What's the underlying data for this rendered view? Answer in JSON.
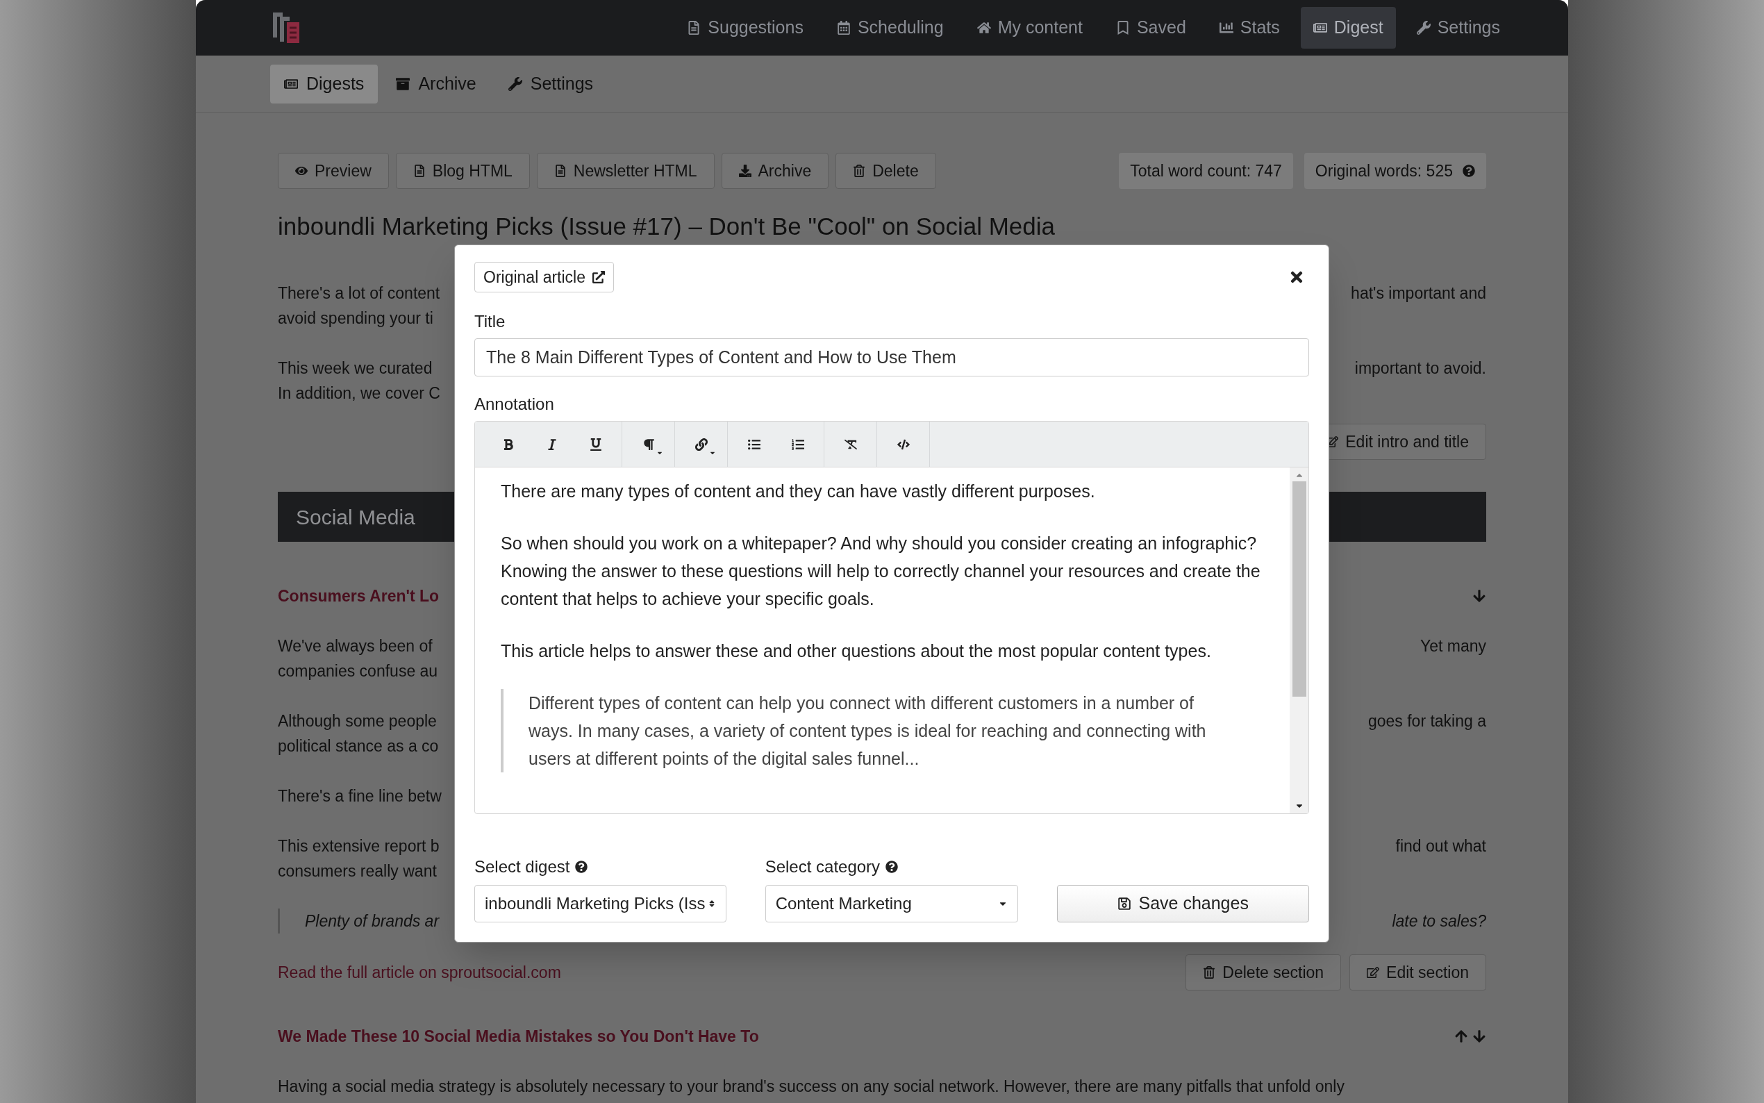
{
  "nav": {
    "items": [
      {
        "label": "Suggestions",
        "selected": false
      },
      {
        "label": "Scheduling",
        "selected": false
      },
      {
        "label": "My content",
        "selected": false
      },
      {
        "label": "Saved",
        "selected": false
      },
      {
        "label": "Stats",
        "selected": false
      },
      {
        "label": "Digest",
        "selected": true
      },
      {
        "label": "Settings",
        "selected": false
      }
    ]
  },
  "subnav": {
    "items": [
      {
        "label": "Digests",
        "selected": true
      },
      {
        "label": "Archive",
        "selected": false
      },
      {
        "label": "Settings",
        "selected": false
      }
    ]
  },
  "toolbar": {
    "buttons": [
      "Preview",
      "Blog HTML",
      "Newsletter HTML",
      "Archive",
      "Delete"
    ],
    "word_count": "Total word count: 747",
    "original_words": "Original words: 525"
  },
  "digest": {
    "heading": "inboundli Marketing Picks (Issue #17) – Don't Be \"Cool\" on Social Media",
    "intro": [
      {
        "lines": [
          {
            "left": "There's a lot of content",
            "right": "hat's important and"
          },
          {
            "left": "avoid spending your ti"
          }
        ]
      },
      {
        "lines": [
          {
            "left": "This week we curated",
            "right": "important to avoid."
          },
          {
            "left": "In addition, we cover C"
          }
        ]
      }
    ],
    "edit_button": "Edit intro and title"
  },
  "section": {
    "title": "Social Media",
    "articles": [
      {
        "title": "Consumers Aren't Lo",
        "can_move_up": false,
        "can_move_down": true,
        "blocks": [
          {
            "kind": "text",
            "lines": [
              {
                "left": "We've always been of",
                "right": "Yet many"
              },
              {
                "left": "companies confuse au"
              }
            ]
          },
          {
            "kind": "text",
            "lines": [
              {
                "left": "Although some people",
                "right": "goes for taking a"
              },
              {
                "left": "political stance as a co"
              }
            ]
          },
          {
            "kind": "text",
            "lines": [
              {
                "left": "There's a fine line betw"
              }
            ]
          },
          {
            "kind": "text",
            "lines": [
              {
                "left": "This extensive report b",
                "right": "find out what"
              },
              {
                "left": "consumers really want"
              }
            ]
          },
          {
            "kind": "quote",
            "lines": [
              {
                "left": "Plenty of brands ar",
                "right": "late to sales?"
              }
            ]
          }
        ],
        "link": "Read the full article on sproutsocial.com",
        "delete_button": "Delete section",
        "edit_button": "Edit section"
      },
      {
        "title": "We Made These 10 Social Media Mistakes so You Don't Have To",
        "can_move_up": true,
        "can_move_down": true,
        "blocks": [
          {
            "kind": "text",
            "lines": [
              {
                "left": "Having a social media strategy is absolutely necessary to your brand's success on any social network. However, there are many pitfalls that unfold only"
              }
            ]
          }
        ]
      }
    ]
  },
  "modal": {
    "original_article": "Original article",
    "title_label": "Title",
    "title_value": "The 8 Main Different Types of Content and How to Use Them",
    "annotation_label": "Annotation",
    "annotation": [
      {
        "kind": "paragraph",
        "text": "There are many types of content and they can have vastly different purposes."
      },
      {
        "kind": "paragraph",
        "text": "So when should you work on a whitepaper? And why should you consider creating an infographic? Knowing the answer to these questions will help to correctly channel your resources and create the content that helps to achieve your specific goals."
      },
      {
        "kind": "paragraph",
        "text": "This article helps to answer these and other questions about the most popular content types."
      },
      {
        "kind": "quote",
        "text": "Different types of content can help you connect with different customers in a number of ways. In many cases, a variety of content types is ideal for reaching and connecting with users at different points of the digital sales funnel..."
      }
    ],
    "digest": {
      "label": "Select digest",
      "value": "inboundli Marketing Picks (Iss"
    },
    "category": {
      "label": "Select category",
      "value": "Content Marketing"
    },
    "save_button": "Save changes"
  }
}
